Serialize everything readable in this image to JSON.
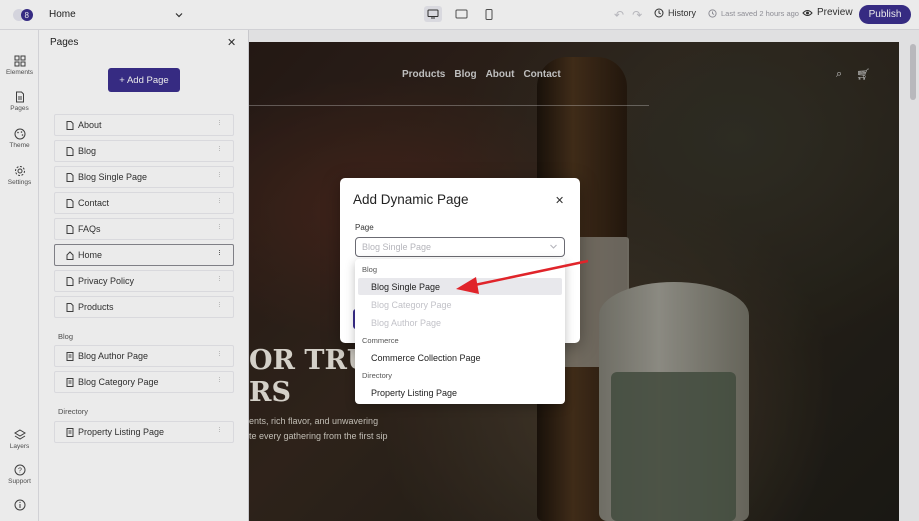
{
  "topbar": {
    "page_selector_value": "Home",
    "history_label": "History",
    "last_saved": "Last saved 2 hours ago",
    "preview_label": "Preview",
    "publish_label": "Publish",
    "active_device": "desktop"
  },
  "rail": {
    "items": [
      {
        "label": "Elements",
        "icon": "grid-icon"
      },
      {
        "label": "Pages",
        "icon": "page-icon"
      },
      {
        "label": "Theme",
        "icon": "palette-icon"
      },
      {
        "label": "Settings",
        "icon": "gear-icon"
      },
      {
        "label": "Layers",
        "icon": "layers-icon"
      },
      {
        "label": "Support",
        "icon": "help-icon"
      }
    ]
  },
  "panel": {
    "title": "Pages",
    "add_page_label": "+ Add Page",
    "pages": [
      {
        "label": "About"
      },
      {
        "label": "Blog"
      },
      {
        "label": "Blog Single Page"
      },
      {
        "label": "Contact"
      },
      {
        "label": "FAQs"
      },
      {
        "label": "Home"
      },
      {
        "label": "Privacy Policy"
      },
      {
        "label": "Products"
      }
    ],
    "blog_group_label": "Blog",
    "blog_pages": [
      {
        "label": "Blog Author Page"
      },
      {
        "label": "Blog Category Page"
      }
    ],
    "directory_group_label": "Directory",
    "directory_pages": [
      {
        "label": "Property Listing Page"
      }
    ]
  },
  "canvas": {
    "nav": [
      "Products",
      "Blog",
      "About",
      "Contact"
    ],
    "hero_line1": "OR TRU",
    "hero_line2": "RS",
    "hero_sub1": "ents, rich flavor, and unwavering",
    "hero_sub2": "te every gathering from the first sip"
  },
  "modal": {
    "title": "Add Dynamic Page",
    "field_label": "Page",
    "select_placeholder": "Blog Single Page"
  },
  "dropdown": {
    "groups": [
      {
        "label": "Blog",
        "options": [
          {
            "label": "Blog Single Page",
            "state": "highlighted"
          },
          {
            "label": "Blog Category Page",
            "state": "disabled"
          },
          {
            "label": "Blog Author Page",
            "state": "disabled"
          }
        ]
      },
      {
        "label": "Commerce",
        "options": [
          {
            "label": "Commerce Collection Page",
            "state": "enabled"
          }
        ]
      },
      {
        "label": "Directory",
        "options": [
          {
            "label": "Property Listing Page",
            "state": "enabled"
          }
        ]
      }
    ]
  },
  "colors": {
    "accent": "#3b2f8e",
    "annotation_arrow": "#e0242a"
  }
}
